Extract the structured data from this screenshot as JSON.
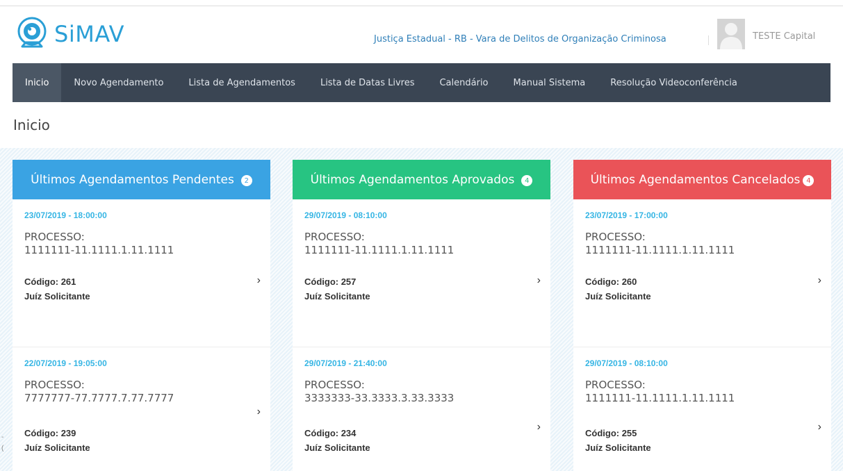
{
  "app": {
    "logo_text": "SiMAV",
    "court": "Justiça Estadual - RB - Vara de Delitos de Organização Criminosa",
    "user": "TESTE Capital"
  },
  "nav": {
    "items": [
      "Inicio",
      "Novo Agendamento",
      "Lista de Agendamentos",
      "Lista de Datas Livres",
      "Calendário",
      "Manual Sistema",
      "Resolução Videoconferência"
    ]
  },
  "page": {
    "title": "Inicio"
  },
  "panels": [
    {
      "title": "Últimos Agendamentos Pendentes",
      "count": "2",
      "items": [
        {
          "date": "23/07/2019 - 18:00:00",
          "process_label": "PROCESSO:",
          "process": "1111111-11.1111.1.11.1111",
          "code": "Código: 261",
          "role": "Juíz Solicitante"
        },
        {
          "date": "22/07/2019 - 19:05:00",
          "process_label": "PROCESSO:",
          "process": "7777777-77.7777.7.77.7777",
          "code": "Código: 239",
          "role": "Juíz Solicitante"
        }
      ]
    },
    {
      "title": "Últimos Agendamentos Aprovados",
      "count": "4",
      "items": [
        {
          "date": "29/07/2019 - 08:10:00",
          "process_label": "PROCESSO:",
          "process": "1111111-11.1111.1.11.1111",
          "code": "Código: 257",
          "role": "Juíz Solicitante"
        },
        {
          "date": "29/07/2019 - 21:40:00",
          "process_label": "PROCESSO:",
          "process": "3333333-33.3333.3.33.3333",
          "code": "Código: 234",
          "role": "Juíz Solicitante"
        }
      ]
    },
    {
      "title": "Últimos Agendamentos Cancelados",
      "count": "4",
      "items": [
        {
          "date": "23/07/2019 - 17:00:00",
          "process_label": "PROCESSO:",
          "process": "1111111-11.1111.1.11.1111",
          "code": "Código: 260",
          "role": "Juíz Solicitante"
        },
        {
          "date": "29/07/2019 - 08:10:00",
          "process_label": "PROCESSO:",
          "process": "1111111-11.1111.1.11.1111",
          "code": "Código: 255",
          "role": "Juíz Solicitante"
        }
      ]
    }
  ],
  "icons": {
    "logo": "webcam-icon",
    "avatar": "user-avatar-icon",
    "chevron": "chevron-right-icon",
    "chevron_glyph": "›"
  },
  "colors": {
    "brand": "#2a9fd6",
    "nav_bg": "#3a4553",
    "pending": "#3aa3e3",
    "approved": "#27c482",
    "cancelled": "#ea5358",
    "date": "#35b5e4"
  }
}
